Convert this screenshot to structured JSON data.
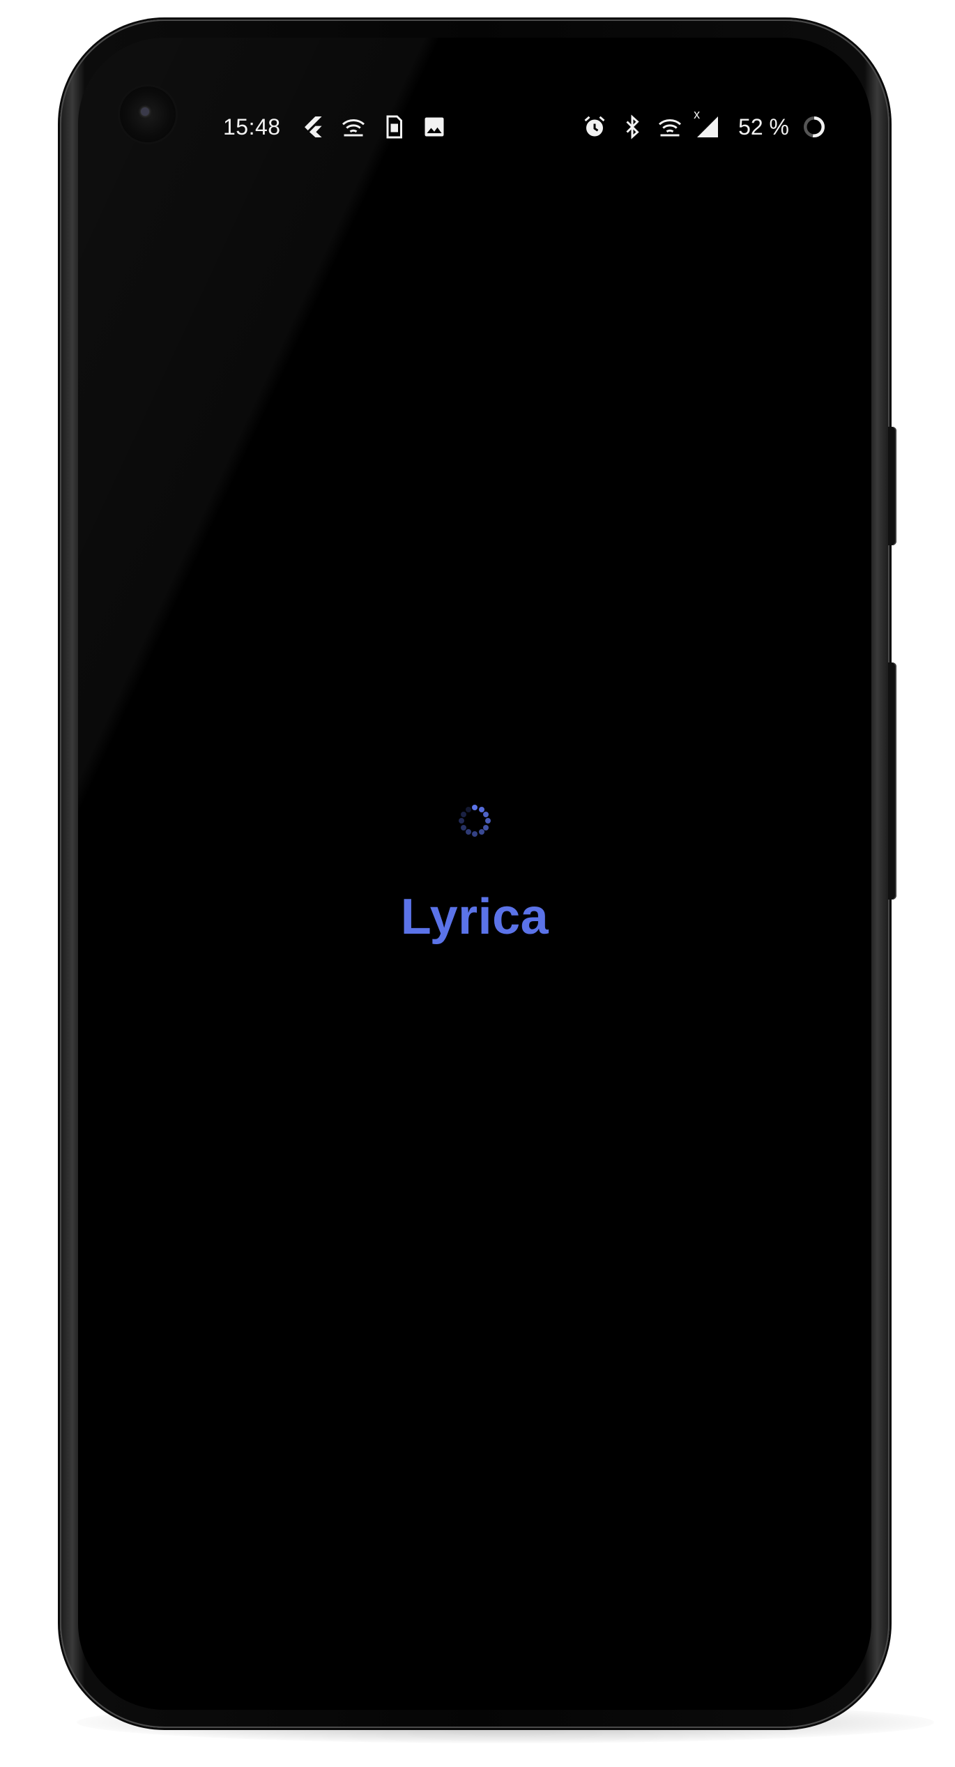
{
  "status_bar": {
    "time": "15:48",
    "left_icons": [
      "flutter-icon",
      "wifi-hotspot-icon",
      "sim-card-icon",
      "image-icon"
    ],
    "right_icons": [
      "alarm-icon",
      "bluetooth-icon",
      "wifi-icon",
      "cellular-signal-icon"
    ],
    "signal_badge": "x",
    "battery_percent": "52 %"
  },
  "splash": {
    "title": "Lyrica",
    "spinner": "loading-spinner"
  },
  "colors": {
    "accent": "#5b73e8",
    "background": "#000000",
    "status_text": "#f2f2f2"
  }
}
